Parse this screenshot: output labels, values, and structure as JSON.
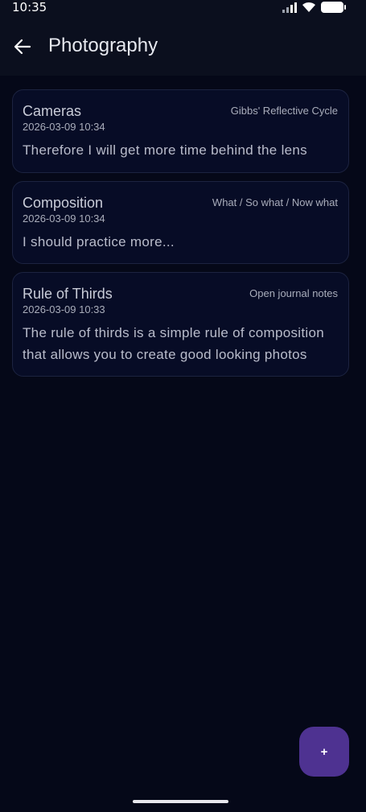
{
  "status_bar": {
    "time": "10:35",
    "icons": [
      "signal-icon",
      "wifi-icon",
      "battery-icon"
    ]
  },
  "app_bar": {
    "title": "Photography",
    "back_icon": "arrow-left-icon"
  },
  "entries": [
    {
      "title": "Cameras",
      "tag": "Gibbs' Reflective Cycle",
      "date": "2026-03-09 10:34",
      "body": "Therefore I will get more time behind the lens"
    },
    {
      "title": "Composition",
      "tag": "What / So what / Now what",
      "date": "2026-03-09 10:34",
      "body": "I should practice more..."
    },
    {
      "title": "Rule of Thirds",
      "tag": "Open journal notes",
      "date": "2026-03-09 10:33",
      "body": "The rule of thirds is a simple rule of composition that allows you to create good looking photos"
    }
  ],
  "fab": {
    "label": "+",
    "color": "#4e3291"
  },
  "colors": {
    "background": "#050818",
    "card": "#070c26",
    "card_border": "#1c2340",
    "accent": "#4e3291"
  }
}
